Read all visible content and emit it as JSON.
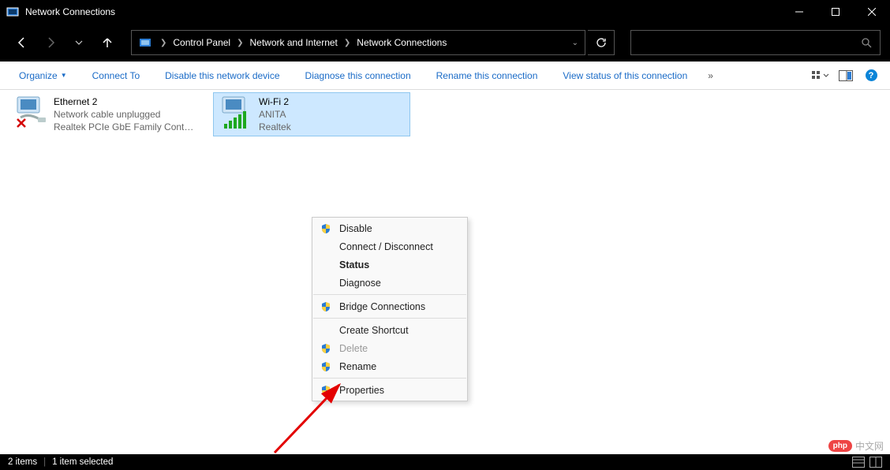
{
  "window": {
    "title": "Network Connections"
  },
  "breadcrumb": {
    "items": [
      "Control Panel",
      "Network and Internet",
      "Network Connections"
    ]
  },
  "toolbar": {
    "organize": "Organize",
    "connect_to": "Connect To",
    "disable": "Disable this network device",
    "diagnose": "Diagnose this connection",
    "rename": "Rename this connection",
    "view_status": "View status of this connection"
  },
  "adapters": [
    {
      "name": "Ethernet 2",
      "status": "Network cable unplugged",
      "device": "Realtek PCIe GbE Family Controller",
      "selected": false,
      "error": true
    },
    {
      "name": "Wi-Fi 2",
      "status": "ANITA",
      "device": "Realtek ",
      "selected": true,
      "signal": true
    }
  ],
  "context_menu": {
    "items": [
      {
        "label": "Disable",
        "shield": true
      },
      {
        "label": "Connect / Disconnect"
      },
      {
        "label": "Status",
        "bold": true
      },
      {
        "label": "Diagnose"
      },
      {
        "sep": true
      },
      {
        "label": "Bridge Connections",
        "shield": true
      },
      {
        "sep": true
      },
      {
        "label": "Create Shortcut"
      },
      {
        "label": "Delete",
        "shield": true,
        "disabled": true
      },
      {
        "label": "Rename",
        "shield": true
      },
      {
        "sep": true
      },
      {
        "label": "Properties",
        "shield": true
      }
    ]
  },
  "statusbar": {
    "items_count": "2 items",
    "selected_count": "1 item selected"
  },
  "watermark": {
    "badge": "php",
    "text": "中文网"
  }
}
